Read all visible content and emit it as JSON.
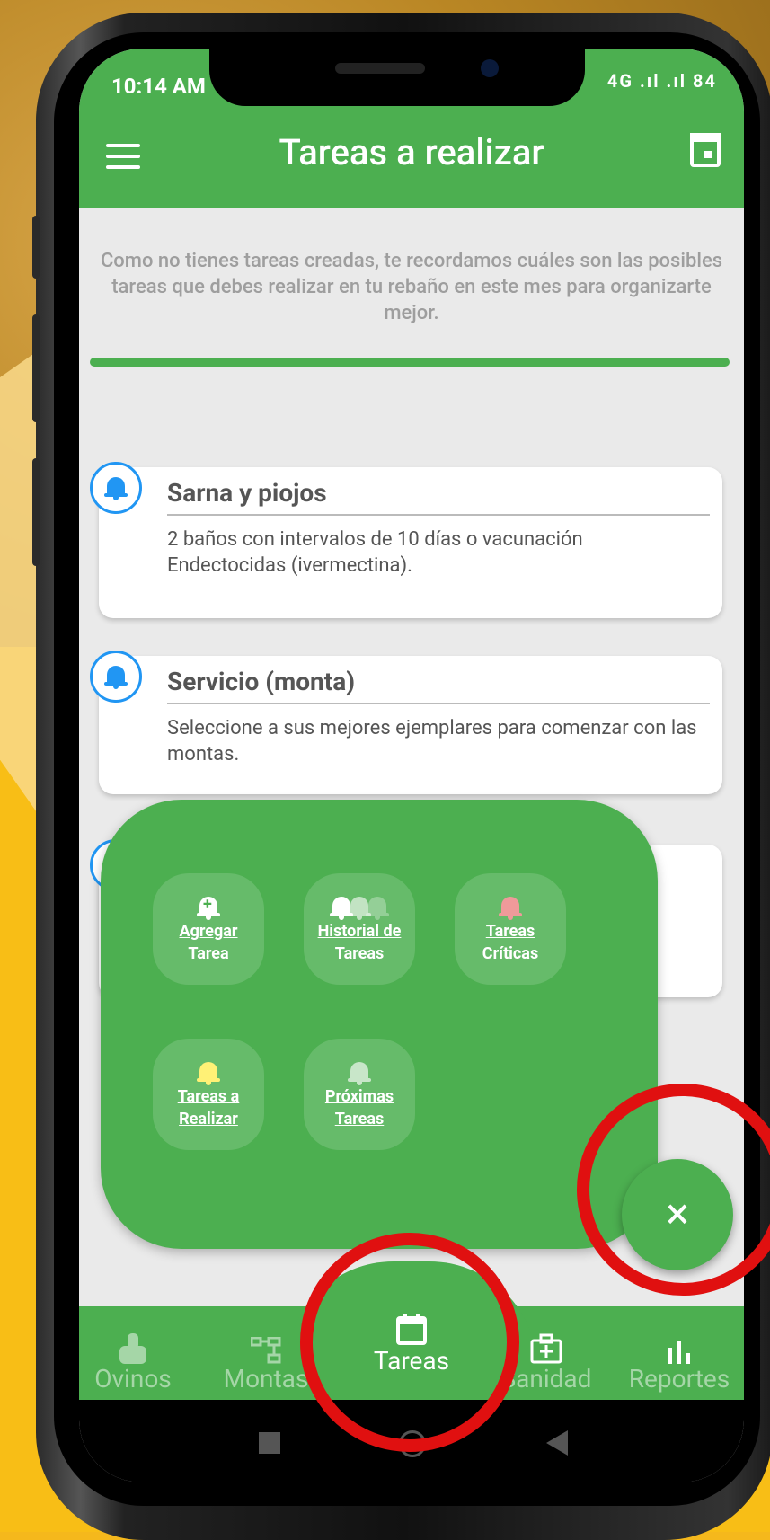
{
  "status_bar": {
    "time": "10:14 AM",
    "icons": "4G .ıl .ıl 84"
  },
  "app_bar": {
    "title": "Tareas a realizar"
  },
  "intro_text": "Como no tienes tareas creadas, te recordamos cuáles son las posibles tareas que debes realizar en tu rebaño en este mes para organizarte mejor.",
  "progress": 1.0,
  "tasks": [
    {
      "title": "Sarna y piojos",
      "description": "2 baños con intervalos de 10 días o vacunación Endectocidas (ivermectina)."
    },
    {
      "title": "Servicio (monta)",
      "description": "Seleccione a sus mejores ejemplares para comenzar con las montas."
    }
  ],
  "fab_menu": {
    "items": [
      {
        "label": "Agregar\nTarea",
        "icon": "bell-plus-icon",
        "color": "#ffffff"
      },
      {
        "label": "Historial de\nTareas",
        "icon": "bell-history-icon",
        "color": "#ffffff"
      },
      {
        "label": "Tareas\nCríticas",
        "icon": "bell-critical-icon",
        "color": "#ef9a9a"
      },
      {
        "label": "Tareas a\nRealizar",
        "icon": "bell-todo-icon",
        "color": "#fff176"
      },
      {
        "label": "Próximas\nTareas",
        "icon": "bell-upcoming-icon",
        "color": "#c8e6c9"
      }
    ],
    "close_symbol": "×"
  },
  "bottom_nav": [
    {
      "label": "Ovinos",
      "icon": "sheep-icon"
    },
    {
      "label": "Montas",
      "icon": "hierarchy-icon"
    },
    {
      "label": "Tareas",
      "icon": "calendar-icon",
      "active": true
    },
    {
      "label": "Sanidad",
      "icon": "medkit-icon"
    },
    {
      "label": "Reportes",
      "icon": "bar-chart-icon"
    }
  ],
  "colors": {
    "primary": "#4caf50",
    "accent_blue": "#2196f3",
    "annotation_red": "#e01010",
    "background_yellow": "#f8be16"
  }
}
